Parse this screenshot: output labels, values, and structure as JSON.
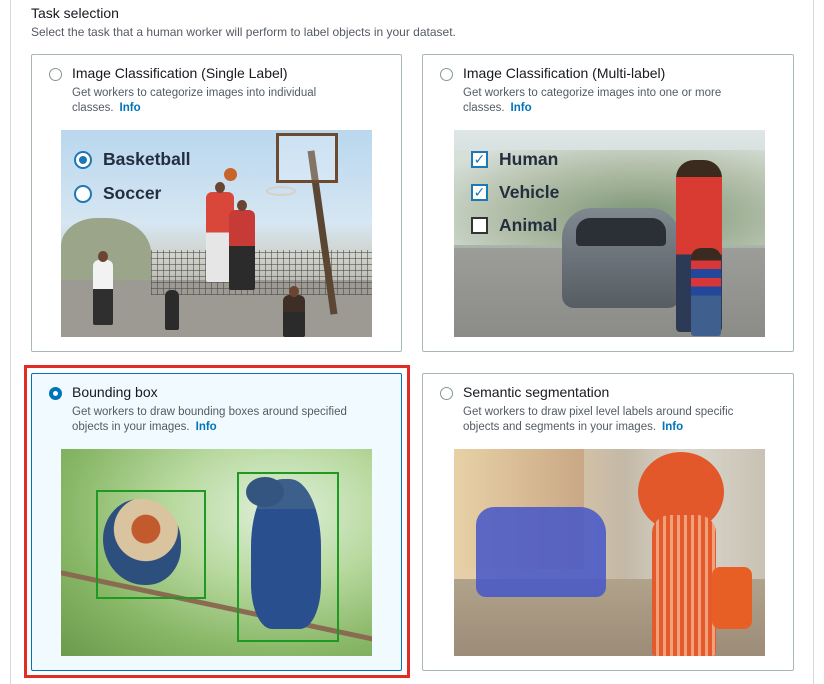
{
  "section": {
    "title": "Task selection",
    "description": "Select the task that a human worker will perform to label objects in your dataset."
  },
  "cards": [
    {
      "title": "Image Classification (Single Label)",
      "description": "Get workers to categorize images into individual classes.",
      "info": "Info",
      "selected": false,
      "image_labels": [
        "Basketball",
        "Soccer"
      ],
      "image_label_states": [
        "selected",
        "unselected"
      ]
    },
    {
      "title": "Image Classification (Multi-label)",
      "description": "Get workers to categorize images into one or more classes.",
      "info": "Info",
      "selected": false,
      "image_labels": [
        "Human",
        "Vehicle",
        "Animal"
      ],
      "image_label_states": [
        "checked",
        "checked",
        "unchecked"
      ]
    },
    {
      "title": "Bounding box",
      "description": "Get workers to draw bounding boxes around specified objects in your images.",
      "info": "Info",
      "selected": true
    },
    {
      "title": "Semantic segmentation",
      "description": "Get workers to draw pixel level labels around specific objects and segments in your images.",
      "info": "Info",
      "selected": false
    }
  ],
  "colors": {
    "accent": "#0073bb",
    "selected_background": "#f1faff",
    "highlight": "#e22d26",
    "bbox": "#1e9a22"
  }
}
